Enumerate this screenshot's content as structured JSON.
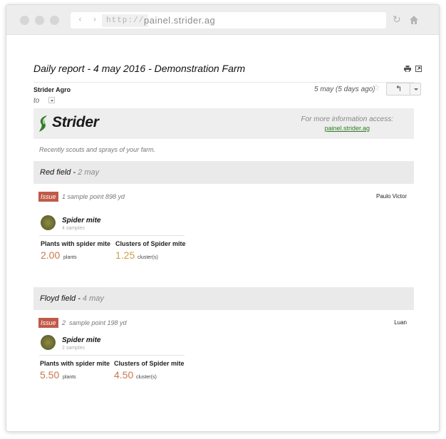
{
  "browser": {
    "protocol": "http://",
    "url": "painel.strider.ag"
  },
  "email": {
    "subject": "Daily report - 4 may 2016 - Demonstration Farm",
    "sender": "Strider Agro",
    "to_label": "to",
    "date": "5 may (5 days ago)"
  },
  "banner": {
    "brand": "Strider",
    "info_text": "For more information access:",
    "info_link": "painel.strider.ag",
    "brand_color": "#2e7d22"
  },
  "intro": "Recently scouts and sprays of your farm.",
  "fields": [
    {
      "name": "Red field",
      "date": "2 may",
      "issue_label": "Issue",
      "samples_text": "1 sample point 898 yd",
      "scout": "Paulo Victor",
      "pest": "Spider mite",
      "pest_samples": "4 samples",
      "metrics": [
        {
          "label": "Plants with spider mite",
          "value": "2.00",
          "unit": "plants",
          "color": "#c9774f"
        },
        {
          "label": "Clusters of Spider mite",
          "value": "1.25",
          "unit": "cluster(s)",
          "color": "#c9a14a"
        }
      ]
    },
    {
      "name": "Floyd field",
      "date": "4 may",
      "issue_label": "Issue",
      "samples_text": "2  sample point 198 yd",
      "scout": "Luan",
      "pest": "Spider mite",
      "pest_samples": "2 samples",
      "metrics": [
        {
          "label": "Plants with spider mite",
          "value": "5.50",
          "unit": "plants",
          "color": "#c9774f"
        },
        {
          "label": "Clusters of Spider mite",
          "value": "4.50",
          "unit": "cluster(s)",
          "color": "#c9774f"
        }
      ]
    }
  ]
}
